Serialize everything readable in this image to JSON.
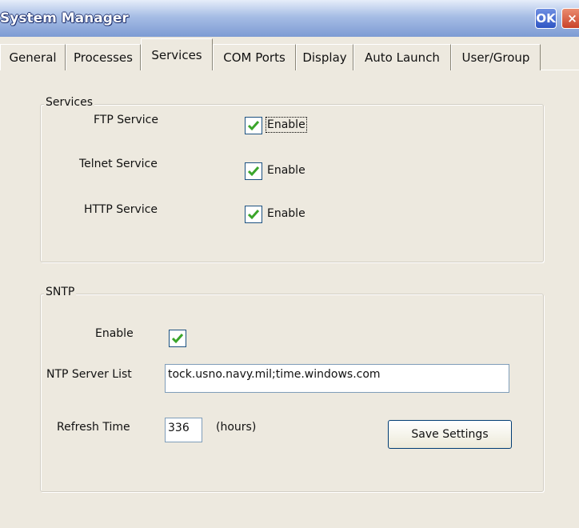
{
  "window": {
    "title": "System Manager",
    "ok_label": "OK",
    "close_label": "×"
  },
  "tabs": [
    {
      "label": "General"
    },
    {
      "label": "Processes"
    },
    {
      "label": "Services"
    },
    {
      "label": "COM Ports"
    },
    {
      "label": "Display"
    },
    {
      "label": "Auto Launch"
    },
    {
      "label": "User/Group"
    }
  ],
  "active_tab": "Services",
  "services_group": {
    "legend": "Services",
    "rows": [
      {
        "label": "FTP Service",
        "checkbox_label": "Enable",
        "checked": true
      },
      {
        "label": "Telnet Service",
        "checkbox_label": "Enable",
        "checked": true
      },
      {
        "label": "HTTP Service",
        "checkbox_label": "Enable",
        "checked": true
      }
    ]
  },
  "sntp_group": {
    "legend": "SNTP",
    "enable_label": "Enable",
    "enable_checked": true,
    "server_list_label": "NTP Server List",
    "server_list_value": "tock.usno.navy.mil;time.windows.com",
    "refresh_label": "Refresh Time",
    "refresh_value": "336",
    "refresh_unit": "(hours)",
    "save_button": "Save Settings"
  },
  "colors": {
    "check_green": "#3aa52a",
    "titlebar": "#7d9bd3",
    "background": "#ede9df"
  }
}
